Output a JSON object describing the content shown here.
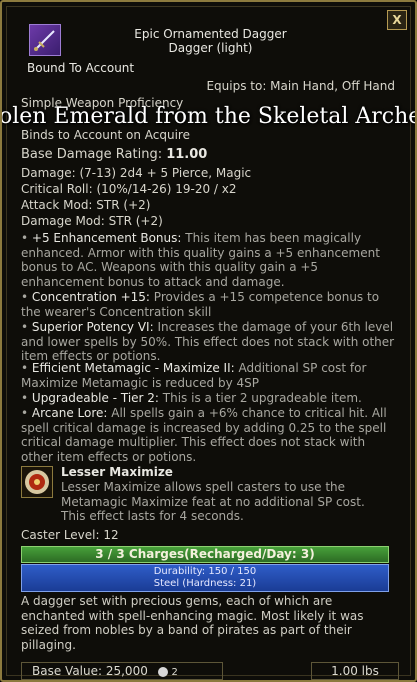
{
  "item": {
    "name": "Epic Ornamented Dagger",
    "type": "Dagger (light)",
    "bound": "Bound To Account",
    "equips": "Equips to: Main Hand, Off Hand",
    "proficiency": "Simple Weapon Proficiency",
    "binds": "Binds to Account on Acquire"
  },
  "overlay_text": "olen Emerald from the Skeletal Archer Ex-P",
  "stats": {
    "base_damage_label": "Base Damage Rating:",
    "base_damage_value": "11.00",
    "damage": "Damage: (7-13) 2d4 + 5 Pierce, Magic",
    "critical": "Critical Roll: (10%/14-26) 19-20 / x2",
    "attack_mod": "Attack Mod: STR (+2)",
    "damage_mod": "Damage Mod: STR (+2)"
  },
  "effects": [
    {
      "name": "+5 Enhancement Bonus:",
      "desc": " This item has been magically enhanced. Armor with this quality gains a +5 enhancement bonus to AC. Weapons with this quality gain a +5 enhancement bonus to attack and damage."
    },
    {
      "name": "Concentration +15:",
      "desc": " Provides a +15 competence bonus to the wearer's Concentration skill"
    },
    {
      "name": "Superior Potency VI:",
      "desc": " Increases the damage of your 6th level and lower spells by 50%. This effect does not stack with other item effects or potions."
    },
    {
      "name": "Efficient Metamagic - Maximize II:",
      "desc": " Additional SP cost for Maximize Metamagic is reduced by 4SP"
    },
    {
      "name": "Upgradeable - Tier 2:",
      "desc": " This is a tier 2 upgradeable item."
    },
    {
      "name": "Arcane Lore:",
      "desc": " All spells gain a +6% chance to critical hit. All spell critical damage is increased by adding 0.25 to the spell critical damage multiplier. This effect does not stack with other item effects or potions."
    }
  ],
  "spell": {
    "name": "Lesser Maximize",
    "desc": "Lesser Maximize allows spell casters to use the Metamagic Maximize feat at no additional SP cost. This effect lasts for 4 seconds.",
    "caster_level": "Caster Level:  12"
  },
  "charges": "3 / 3 Charges(Recharged/Day: 3)",
  "durability": "Durability: 150 / 150",
  "material": "Steel (Hardness: 21)",
  "description": "A dagger set with precious gems, each of which are enchanted with spell-enhancing magic. Most likely it was seized from nobles by a band of pirates as part of their pillaging.",
  "footer": {
    "base_value": "Base Value: 25,000",
    "count": "2",
    "weight": "1.00 lbs"
  },
  "close_label": "X",
  "icons": {
    "item": "dagger-icon",
    "spell": "maximize-icon",
    "coin": "coin-icon"
  },
  "colors": {
    "border": "#8c7a3e",
    "charges_bar": "#3c8a30",
    "durability_bar": "#2447b0"
  }
}
